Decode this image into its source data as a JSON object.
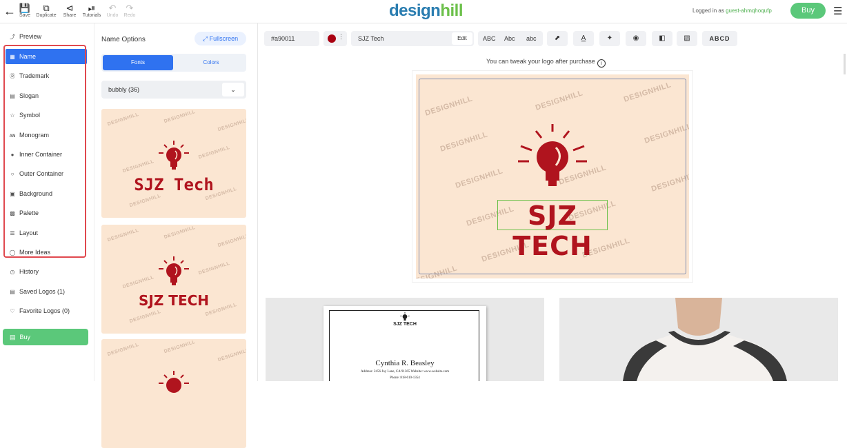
{
  "topbar": {
    "buttons": [
      {
        "label": "Save",
        "icon": "save-icon"
      },
      {
        "label": "Duplicate",
        "icon": "duplicate-icon"
      },
      {
        "label": "Share",
        "icon": "share-icon"
      },
      {
        "label": "Tutorials",
        "icon": "play-icon"
      },
      {
        "label": "Undo",
        "icon": "undo-icon"
      },
      {
        "label": "Redo",
        "icon": "redo-icon"
      }
    ],
    "logo": {
      "part1": "design",
      "part2": "hill"
    },
    "logged_in_label": "Logged in as",
    "username": "guest-ahmqhoqufp",
    "buy_label": "Buy"
  },
  "sidebar": {
    "items": [
      {
        "label": "Preview",
        "icon": "preview-icon"
      },
      {
        "label": "Name",
        "icon": "name-icon"
      },
      {
        "label": "Trademark",
        "icon": "trademark-icon"
      },
      {
        "label": "Slogan",
        "icon": "slogan-icon"
      },
      {
        "label": "Symbol",
        "icon": "star-icon"
      },
      {
        "label": "Monogram",
        "icon": "monogram-icon"
      },
      {
        "label": "Inner Container",
        "icon": "inner-container-icon"
      },
      {
        "label": "Outer Container",
        "icon": "outer-container-icon"
      },
      {
        "label": "Background",
        "icon": "background-icon"
      },
      {
        "label": "Palette",
        "icon": "palette-icon"
      },
      {
        "label": "Layout",
        "icon": "layout-icon"
      },
      {
        "label": "More Ideas",
        "icon": "bulb-icon"
      },
      {
        "label": "History",
        "icon": "history-icon"
      },
      {
        "label": "Saved Logos (1)",
        "icon": "saved-icon"
      },
      {
        "label": "Favorite Logos (0)",
        "icon": "heart-icon"
      }
    ],
    "buy_label": "Buy"
  },
  "options": {
    "title": "Name Options",
    "fullscreen_label": "Fullscreen",
    "tabs": [
      "Fonts",
      "Colors"
    ],
    "font_select": "bubbly (36)",
    "cards": [
      {
        "text": "SJZ Tech"
      },
      {
        "text": "SJZ TECH"
      },
      {
        "text": ""
      }
    ],
    "watermark": "DESIGNHILL"
  },
  "toolbar": {
    "hex": "#a90011",
    "color": "#a90011",
    "name_value": "SJZ Tech",
    "edit_label": "Edit",
    "case_options": [
      "ABC",
      "Abc",
      "abc"
    ],
    "spacing_label": "A",
    "font_sample": "ABCD"
  },
  "canvas": {
    "tweak_note": "You can tweak your logo after purchase",
    "logo_text": "SJZ TECH",
    "watermark": "DESIGNHILL"
  },
  "mockups": {
    "card_logo_text": "SJZ TECH",
    "person_name": "Cynthia R. Beasley",
    "address_line": "Address:  2456 Joy Lane, CA 91365       Website:  www.website.com",
    "phone_line": "Phone:  818-610-1354"
  }
}
